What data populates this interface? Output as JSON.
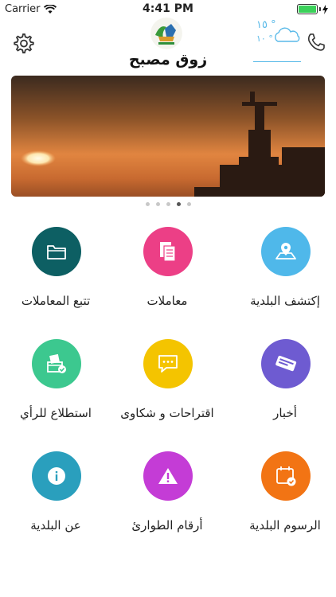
{
  "status_bar": {
    "carrier": "Carrier",
    "time": "4:41 PM"
  },
  "header": {
    "title": "زوق مصبح",
    "weather": {
      "temp_line": "١٥ °",
      "sub_line": "١٠ °"
    }
  },
  "banner": {
    "slide_count": 5,
    "active_slide": 4
  },
  "tiles": [
    {
      "label": "إكتشف البلدية",
      "color": "#4fb8ea",
      "icon": "map-pin-icon"
    },
    {
      "label": "معاملات",
      "color": "#ec3f86",
      "icon": "document-icon"
    },
    {
      "label": "تتبع المعاملات",
      "color": "#0d5f63",
      "icon": "folder-icon"
    },
    {
      "label": "أخبار",
      "color": "#6e5bd1",
      "icon": "news-icon"
    },
    {
      "label": "اقتراحات و شكاوى",
      "color": "#f4c400",
      "icon": "chat-icon"
    },
    {
      "label": "استطلاع للرأي",
      "color": "#3cc88f",
      "icon": "ballot-icon"
    },
    {
      "label": "الرسوم البلدية",
      "color": "#f27414",
      "icon": "calendar-check-icon"
    },
    {
      "label": "أرقام الطوارئ",
      "color": "#c43cd6",
      "icon": "warning-icon"
    },
    {
      "label": "عن البلدية",
      "color": "#2a9fbd",
      "icon": "info-icon"
    }
  ]
}
